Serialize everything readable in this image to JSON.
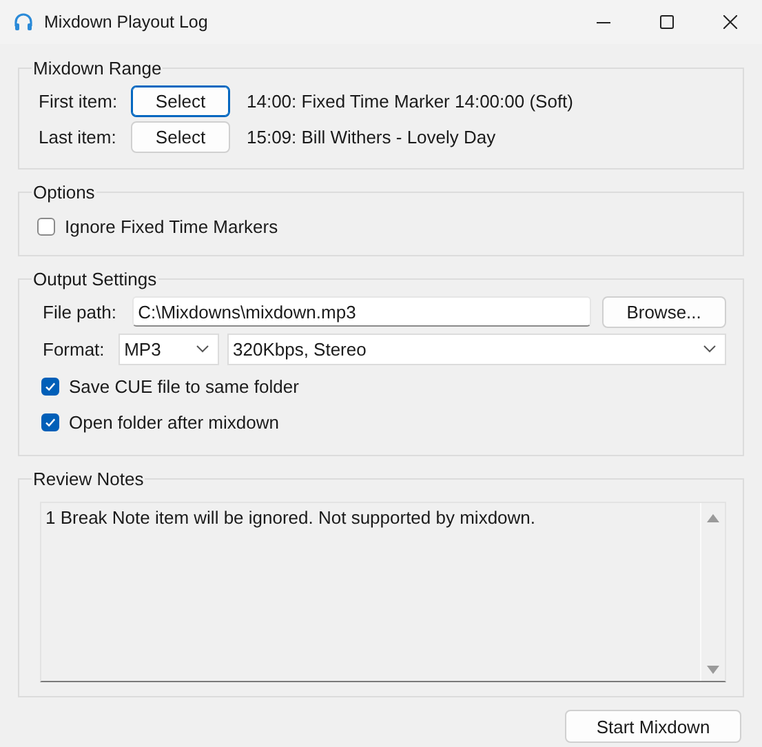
{
  "window": {
    "title": "Mixdown Playout Log"
  },
  "mixdown_range": {
    "title": "Mixdown Range",
    "items": [
      {
        "label": "First item:",
        "button": "Select",
        "value": "14:00: Fixed Time Marker 14:00:00 (Soft)",
        "focused": true
      },
      {
        "label": "Last item:",
        "button": "Select",
        "value": "15:09: Bill Withers - Lovely Day",
        "focused": false
      }
    ]
  },
  "options": {
    "title": "Options",
    "checkboxes": [
      {
        "label": "Ignore Fixed Time Markers",
        "checked": false
      }
    ]
  },
  "output_settings": {
    "title": "Output Settings",
    "file_path": {
      "label": "File path:",
      "value": "C:\\Mixdowns\\mixdown.mp3"
    },
    "browse_button": "Browse...",
    "format": {
      "label": "Format:",
      "type": "MP3",
      "quality": "320Kbps, Stereo"
    },
    "checkboxes": [
      {
        "label": "Save CUE file to same folder",
        "checked": true
      },
      {
        "label": "Open folder after mixdown",
        "checked": true
      }
    ]
  },
  "review_notes": {
    "title": "Review Notes",
    "text": "1 Break Note item will be ignored. Not supported by mixdown."
  },
  "buttons": [
    "Start Mixdown"
  ]
}
